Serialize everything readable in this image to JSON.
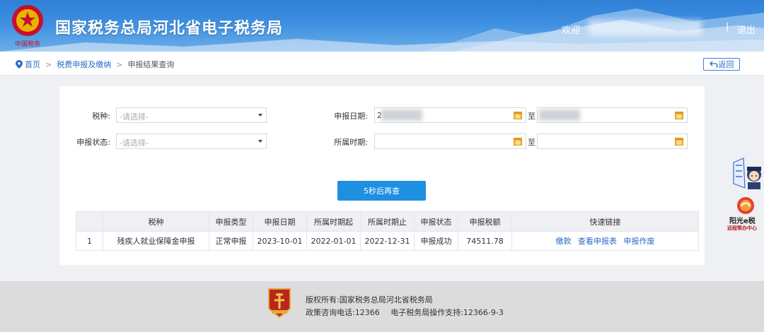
{
  "header": {
    "title": "国家税务总局河北省电子税务局",
    "welcome": "欢迎",
    "divider": "|",
    "logout": "退出"
  },
  "breadcrumb": {
    "home": "首页",
    "level1": "税费申报及缴纳",
    "current": "申报结果查询",
    "separator": ">"
  },
  "back_button": "返回",
  "form": {
    "tax_type_label": "税种:",
    "tax_type_placeholder": "-请选择-",
    "status_label": "申报状态:",
    "status_placeholder": "-请选择-",
    "declare_date_label": "申报日期:",
    "declare_date_from": "2",
    "belong_period_label": "所属时期:",
    "to": "至"
  },
  "query_button": "5秒后再查",
  "table": {
    "headers": [
      "",
      "税种",
      "申报类型",
      "申报日期",
      "所属时期起",
      "所属时期止",
      "申报状态",
      "申报税额",
      "快速链接"
    ],
    "rows": [
      {
        "index": "1",
        "tax_type": "残疾人就业保障金申报",
        "declare_type": "正常申报",
        "declare_date": "2023-10-01",
        "period_start": "2022-01-01",
        "period_end": "2022-12-31",
        "status": "申报成功",
        "amount": "74511.78",
        "links": [
          "缴款",
          "查看申报表",
          "申报作废"
        ]
      }
    ]
  },
  "float": {
    "widget2_title": "阳光e税",
    "widget2_sub": "远程帮办中心"
  },
  "footer": {
    "copyright": "版权所有:国家税务总局河北省税务局",
    "hotline": "政策咨询电话:12366",
    "support": "电子税务局操作支持:12366-9-3"
  },
  "colors": {
    "header_blue": "#2f7fd8",
    "link_blue": "#2b6cc4",
    "button_blue": "#1e8fe1"
  }
}
